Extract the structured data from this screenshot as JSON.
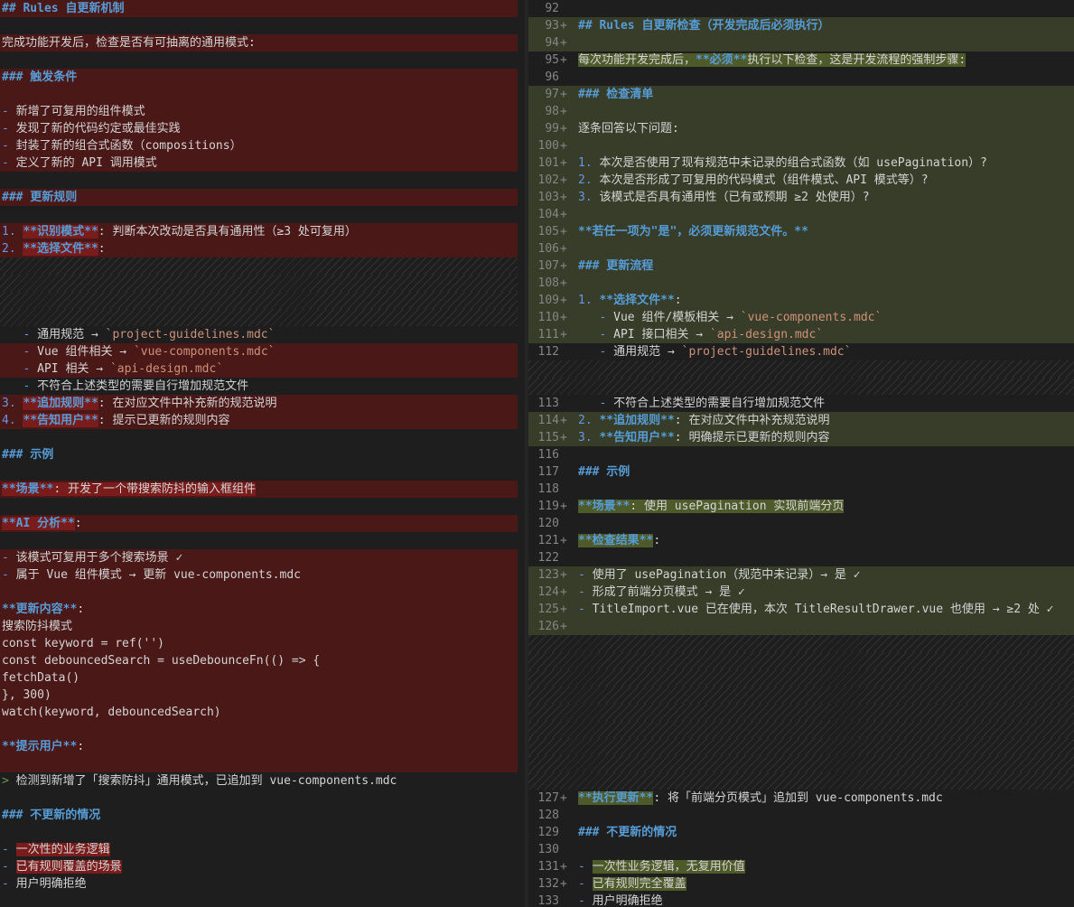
{
  "left_lines": [
    {
      "t": "del",
      "s": [
        {
          "x": "## Rules 自更新机制",
          "c": "head"
        }
      ]
    },
    {
      "t": "",
      "s": []
    },
    {
      "t": "del",
      "s": [
        {
          "x": "完成功能开发后，检查是否有可抽离的通用模式:",
          "c": "plain"
        }
      ]
    },
    {
      "t": "",
      "s": []
    },
    {
      "t": "del",
      "s": [
        {
          "x": "### 触发条件",
          "c": "head"
        }
      ]
    },
    {
      "t": "del",
      "s": []
    },
    {
      "t": "del",
      "s": [
        {
          "x": "- ",
          "c": "list"
        },
        {
          "x": "新增了可复用的组件模式",
          "c": "plain"
        }
      ]
    },
    {
      "t": "del",
      "s": [
        {
          "x": "- ",
          "c": "list"
        },
        {
          "x": "发现了新的代码约定或最佳实践",
          "c": "plain"
        }
      ]
    },
    {
      "t": "del",
      "s": [
        {
          "x": "- ",
          "c": "list"
        },
        {
          "x": "封装了新的组合式函数（compositions）",
          "c": "plain"
        }
      ]
    },
    {
      "t": "del",
      "s": [
        {
          "x": "- ",
          "c": "list"
        },
        {
          "x": "定义了新的 API 调用模式",
          "c": "plain"
        }
      ]
    },
    {
      "t": "",
      "s": []
    },
    {
      "t": "del",
      "s": [
        {
          "x": "### 更新规则",
          "c": "head"
        }
      ]
    },
    {
      "t": "",
      "s": []
    },
    {
      "t": "del",
      "s": [
        {
          "x": "1. ",
          "c": "list"
        },
        {
          "x": "**识别模式**",
          "c": "head",
          "h": 1
        },
        {
          "x": ": 判断本次改动是否具有通用性（≥3 处可复用）",
          "c": "plain"
        }
      ]
    },
    {
      "t": "del",
      "s": [
        {
          "x": "2. ",
          "c": "list"
        },
        {
          "x": "**选择文件**",
          "c": "head",
          "h": 1
        },
        {
          "x": ":",
          "c": "plain"
        }
      ]
    },
    {
      "t": "hatch",
      "s": []
    },
    {
      "t": "hatch",
      "s": []
    },
    {
      "t": "hatch",
      "s": []
    },
    {
      "t": "hatch",
      "s": []
    },
    {
      "t": "",
      "s": [
        {
          "x": "   - ",
          "c": "list"
        },
        {
          "x": "通用规范 → ",
          "c": "plain"
        },
        {
          "x": "`project-guidelines.mdc`",
          "c": "code"
        }
      ]
    },
    {
      "t": "del",
      "s": [
        {
          "x": "   - ",
          "c": "list"
        },
        {
          "x": "Vue 组件相关 → ",
          "c": "plain"
        },
        {
          "x": "`vue-components.mdc`",
          "c": "code"
        }
      ]
    },
    {
      "t": "del",
      "s": [
        {
          "x": "   - ",
          "c": "list"
        },
        {
          "x": "API 相关 → ",
          "c": "plain"
        },
        {
          "x": "`api-design.mdc`",
          "c": "code"
        }
      ]
    },
    {
      "t": "",
      "s": [
        {
          "x": "   - ",
          "c": "list"
        },
        {
          "x": "不符合上述类型的需要自行增加规范文件",
          "c": "plain"
        }
      ]
    },
    {
      "t": "del",
      "s": [
        {
          "x": "3. ",
          "c": "list"
        },
        {
          "x": "**追加规则**",
          "c": "head",
          "h": 1
        },
        {
          "x": ": 在对应文件中补充新的规范说明",
          "c": "plain"
        }
      ]
    },
    {
      "t": "del",
      "s": [
        {
          "x": "4. ",
          "c": "list"
        },
        {
          "x": "**告知用户**",
          "c": "head",
          "h": 1
        },
        {
          "x": ": 提示已更新的规则内容",
          "c": "plain"
        }
      ]
    },
    {
      "t": "",
      "s": []
    },
    {
      "t": "",
      "s": [
        {
          "x": "### 示例",
          "c": "head"
        }
      ]
    },
    {
      "t": "",
      "s": []
    },
    {
      "t": "del",
      "s": [
        {
          "x": "**场景**",
          "c": "head",
          "h": 1
        },
        {
          "x": ": 开发了一个带搜索防抖的输入框组件",
          "c": "plain",
          "h": 1
        }
      ]
    },
    {
      "t": "",
      "s": []
    },
    {
      "t": "del",
      "s": [
        {
          "x": "**AI 分析**",
          "c": "head",
          "h": 1
        },
        {
          "x": ":",
          "c": "plain"
        }
      ]
    },
    {
      "t": "",
      "s": []
    },
    {
      "t": "del",
      "s": [
        {
          "x": "- ",
          "c": "list"
        },
        {
          "x": "该模式可复用于多个搜索场景 ✓",
          "c": "plain"
        }
      ]
    },
    {
      "t": "del",
      "s": [
        {
          "x": "- ",
          "c": "list"
        },
        {
          "x": "属于 Vue 组件模式 → 更新 vue-components.mdc",
          "c": "plain"
        }
      ]
    },
    {
      "t": "del",
      "s": []
    },
    {
      "t": "del",
      "s": [
        {
          "x": "**更新内容**",
          "c": "head"
        },
        {
          "x": ":",
          "c": "plain"
        }
      ]
    },
    {
      "t": "del",
      "s": [
        {
          "x": "搜索防抖模式",
          "c": "plain"
        }
      ]
    },
    {
      "t": "del",
      "s": [
        {
          "x": "const keyword = ref('')",
          "c": "plain"
        }
      ]
    },
    {
      "t": "del",
      "s": [
        {
          "x": "const debouncedSearch = useDebounceFn(() => {",
          "c": "plain"
        }
      ]
    },
    {
      "t": "del",
      "s": [
        {
          "x": "fetchData()",
          "c": "plain"
        }
      ]
    },
    {
      "t": "del",
      "s": [
        {
          "x": "}, 300)",
          "c": "plain"
        }
      ]
    },
    {
      "t": "del",
      "s": [
        {
          "x": "watch(keyword, debouncedSearch)",
          "c": "plain"
        }
      ]
    },
    {
      "t": "del",
      "s": []
    },
    {
      "t": "del",
      "s": [
        {
          "x": "**提示用户**",
          "c": "head"
        },
        {
          "x": ":",
          "c": "plain"
        }
      ]
    },
    {
      "t": "del",
      "s": []
    },
    {
      "t": "",
      "s": [
        {
          "x": "> ",
          "c": "quote"
        },
        {
          "x": "检测到新增了「搜索防抖」通用模式，已追加到 vue-components.mdc",
          "c": "plain"
        }
      ]
    },
    {
      "t": "",
      "s": []
    },
    {
      "t": "",
      "s": [
        {
          "x": "### 不更新的情况",
          "c": "head"
        }
      ]
    },
    {
      "t": "",
      "s": []
    },
    {
      "t": "",
      "s": [
        {
          "x": "- ",
          "c": "list"
        },
        {
          "x": "一次性的业务逻辑",
          "c": "plain",
          "h": 1
        }
      ]
    },
    {
      "t": "",
      "s": [
        {
          "x": "- ",
          "c": "list"
        },
        {
          "x": "已有规则覆盖的场景",
          "c": "plain",
          "h": 1
        }
      ]
    },
    {
      "t": "",
      "s": [
        {
          "x": "- ",
          "c": "list"
        },
        {
          "x": "用户明确拒绝",
          "c": "plain"
        }
      ]
    }
  ],
  "right_lines": [
    {
      "t": "",
      "n": "92",
      "m": "",
      "s": []
    },
    {
      "t": "add",
      "n": "93",
      "m": "+",
      "s": [
        {
          "x": "## Rules 自更新检查（开发完成后必须执行）",
          "c": "head"
        }
      ]
    },
    {
      "t": "add",
      "n": "94",
      "m": "+",
      "s": []
    },
    {
      "t": "",
      "n": "95",
      "m": "+",
      "s": [
        {
          "x": "每次功能开发完成后，",
          "c": "plain",
          "h": 1
        },
        {
          "x": "**必须**",
          "c": "head",
          "h": 1
        },
        {
          "x": "执行以下检查，这是开发流程的强制步骤:",
          "c": "plain",
          "h": 1
        }
      ]
    },
    {
      "t": "",
      "n": "96",
      "m": "",
      "s": []
    },
    {
      "t": "add",
      "n": "97",
      "m": "+",
      "s": [
        {
          "x": "### 检查清单",
          "c": "head"
        }
      ]
    },
    {
      "t": "add",
      "n": "98",
      "m": "+",
      "s": []
    },
    {
      "t": "add",
      "n": "99",
      "m": "+",
      "s": [
        {
          "x": "逐条回答以下问题:",
          "c": "plain"
        }
      ]
    },
    {
      "t": "add",
      "n": "100",
      "m": "+",
      "s": []
    },
    {
      "t": "add",
      "n": "101",
      "m": "+",
      "s": [
        {
          "x": "1. ",
          "c": "list"
        },
        {
          "x": "本次是否使用了现有规范中未记录的组合式函数（如 usePagination）?",
          "c": "plain"
        }
      ]
    },
    {
      "t": "add",
      "n": "102",
      "m": "+",
      "s": [
        {
          "x": "2. ",
          "c": "list"
        },
        {
          "x": "本次是否形成了可复用的代码模式（组件模式、API 模式等）?",
          "c": "plain"
        }
      ]
    },
    {
      "t": "add",
      "n": "103",
      "m": "+",
      "s": [
        {
          "x": "3. ",
          "c": "list"
        },
        {
          "x": "该模式是否具有通用性（已有或预期 ≥2 处使用）?",
          "c": "plain"
        }
      ]
    },
    {
      "t": "add",
      "n": "104",
      "m": "+",
      "s": []
    },
    {
      "t": "add",
      "n": "105",
      "m": "+",
      "s": [
        {
          "x": "**若任一项为\"是\"，必须更新规范文件。**",
          "c": "head"
        }
      ]
    },
    {
      "t": "add",
      "n": "106",
      "m": "+",
      "s": []
    },
    {
      "t": "add",
      "n": "107",
      "m": "+",
      "s": [
        {
          "x": "### 更新流程",
          "c": "head"
        }
      ]
    },
    {
      "t": "add",
      "n": "108",
      "m": "+",
      "s": []
    },
    {
      "t": "add",
      "n": "109",
      "m": "+",
      "s": [
        {
          "x": "1. ",
          "c": "list"
        },
        {
          "x": "**选择文件**",
          "c": "head"
        },
        {
          "x": ":",
          "c": "plain"
        }
      ]
    },
    {
      "t": "add",
      "n": "110",
      "m": "+",
      "s": [
        {
          "x": "   - ",
          "c": "list"
        },
        {
          "x": "Vue 组件/模板相关 → ",
          "c": "plain"
        },
        {
          "x": "`vue-components.mdc`",
          "c": "code"
        }
      ]
    },
    {
      "t": "add",
      "n": "111",
      "m": "+",
      "s": [
        {
          "x": "   - ",
          "c": "list"
        },
        {
          "x": "API 接口相关 → ",
          "c": "plain"
        },
        {
          "x": "`api-design.mdc`",
          "c": "code"
        }
      ]
    },
    {
      "t": "",
      "n": "112",
      "m": "",
      "s": [
        {
          "x": "   - ",
          "c": "list"
        },
        {
          "x": "通用规范 → ",
          "c": "plain"
        },
        {
          "x": "`project-guidelines.mdc`",
          "c": "code"
        }
      ]
    },
    {
      "t": "hatch",
      "n": "",
      "m": "",
      "s": []
    },
    {
      "t": "hatch",
      "n": "",
      "m": "",
      "s": []
    },
    {
      "t": "",
      "n": "113",
      "m": "",
      "s": [
        {
          "x": "   - ",
          "c": "list"
        },
        {
          "x": "不符合上述类型的需要自行增加规范文件",
          "c": "plain"
        }
      ]
    },
    {
      "t": "add",
      "n": "114",
      "m": "+",
      "s": [
        {
          "x": "2. ",
          "c": "list"
        },
        {
          "x": "**追加规则**",
          "c": "head"
        },
        {
          "x": ": 在对应文件中补充规范说明",
          "c": "plain"
        }
      ]
    },
    {
      "t": "add",
      "n": "115",
      "m": "+",
      "s": [
        {
          "x": "3. ",
          "c": "list"
        },
        {
          "x": "**告知用户**",
          "c": "head"
        },
        {
          "x": ": 明确提示已更新的规则内容",
          "c": "plain"
        }
      ]
    },
    {
      "t": "",
      "n": "116",
      "m": "",
      "s": []
    },
    {
      "t": "",
      "n": "117",
      "m": "",
      "s": [
        {
          "x": "### 示例",
          "c": "head"
        }
      ]
    },
    {
      "t": "",
      "n": "118",
      "m": "",
      "s": []
    },
    {
      "t": "",
      "n": "119",
      "m": "+",
      "s": [
        {
          "x": "**场景**",
          "c": "head",
          "h": 1
        },
        {
          "x": ": 使用 usePagination 实现前端分页",
          "c": "plain",
          "h": 1
        }
      ]
    },
    {
      "t": "",
      "n": "120",
      "m": "",
      "s": []
    },
    {
      "t": "",
      "n": "121",
      "m": "+",
      "s": [
        {
          "x": "**检查结果**",
          "c": "head",
          "h": 1
        },
        {
          "x": ":",
          "c": "plain"
        }
      ]
    },
    {
      "t": "",
      "n": "122",
      "m": "",
      "s": []
    },
    {
      "t": "add",
      "n": "123",
      "m": "+",
      "s": [
        {
          "x": "- ",
          "c": "list"
        },
        {
          "x": "使用了 usePagination（规范中未记录）→ 是 ✓",
          "c": "plain"
        }
      ]
    },
    {
      "t": "add",
      "n": "124",
      "m": "+",
      "s": [
        {
          "x": "- ",
          "c": "list"
        },
        {
          "x": "形成了前端分页模式 → 是 ✓",
          "c": "plain"
        }
      ]
    },
    {
      "t": "add",
      "n": "125",
      "m": "+",
      "s": [
        {
          "x": "- ",
          "c": "list"
        },
        {
          "x": "TitleImport.vue 已在使用，本次 TitleResultDrawer.vue 也使用 → ≥2 处 ✓",
          "c": "plain"
        }
      ]
    },
    {
      "t": "add",
      "n": "126",
      "m": "+",
      "s": []
    },
    {
      "t": "hatch",
      "n": "",
      "m": "",
      "s": []
    },
    {
      "t": "hatch",
      "n": "",
      "m": "",
      "s": []
    },
    {
      "t": "hatch",
      "n": "",
      "m": "",
      "s": []
    },
    {
      "t": "hatch",
      "n": "",
      "m": "",
      "s": []
    },
    {
      "t": "hatch",
      "n": "",
      "m": "",
      "s": []
    },
    {
      "t": "hatch",
      "n": "",
      "m": "",
      "s": []
    },
    {
      "t": "hatch",
      "n": "",
      "m": "",
      "s": []
    },
    {
      "t": "hatch",
      "n": "",
      "m": "",
      "s": []
    },
    {
      "t": "hatch",
      "n": "",
      "m": "",
      "s": []
    },
    {
      "t": "",
      "n": "127",
      "m": "+",
      "s": [
        {
          "x": "**执行更新**",
          "c": "head",
          "h": 1
        },
        {
          "x": ": 将「前端分页模式」追加到 vue-components.mdc",
          "c": "plain"
        }
      ]
    },
    {
      "t": "",
      "n": "128",
      "m": "",
      "s": []
    },
    {
      "t": "",
      "n": "129",
      "m": "",
      "s": [
        {
          "x": "### 不更新的情况",
          "c": "head"
        }
      ]
    },
    {
      "t": "",
      "n": "130",
      "m": "",
      "s": []
    },
    {
      "t": "",
      "n": "131",
      "m": "+",
      "s": [
        {
          "x": "- ",
          "c": "list"
        },
        {
          "x": "一次性业务逻辑，无复用价值",
          "c": "plain",
          "h": 1
        }
      ]
    },
    {
      "t": "",
      "n": "132",
      "m": "+",
      "s": [
        {
          "x": "- ",
          "c": "list"
        },
        {
          "x": "已有规则完全覆盖",
          "c": "plain",
          "h": 1
        }
      ]
    },
    {
      "t": "",
      "n": "133",
      "m": "",
      "s": [
        {
          "x": "- ",
          "c": "list"
        },
        {
          "x": "用户明确拒绝",
          "c": "plain"
        }
      ]
    }
  ]
}
